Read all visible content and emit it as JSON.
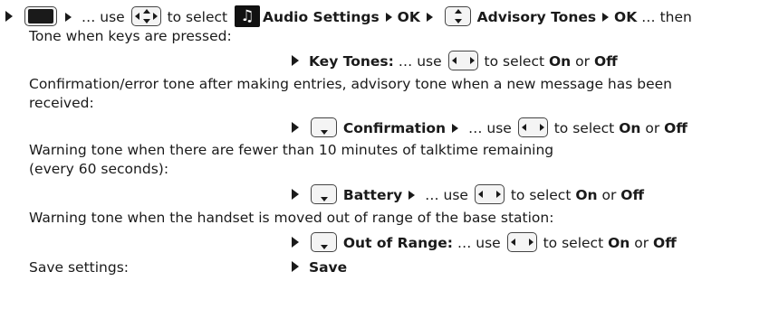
{
  "step1": {
    "prefix": "… use",
    "to_select": "to select",
    "audio_icon": "music-note",
    "audio_settings": "Audio Settings",
    "ok1": "OK",
    "advisory_tones": "Advisory Tones",
    "ok2": "OK",
    "then": "… then"
  },
  "key_tones": {
    "description": "Tone when keys are pressed:",
    "label": "Key Tones:",
    "use": "… use",
    "to_select": "to select",
    "on": "On",
    "or": "or",
    "off": "Off"
  },
  "confirmation": {
    "description_line1": "Confirmation/error tone after making entries, advisory tone when a new message has been",
    "description_line2": "received:",
    "label": "Confirmation",
    "use": "… use",
    "to_select": "to select",
    "on": "On",
    "or": "or",
    "off": "Off"
  },
  "battery": {
    "description_line1": "Warning tone when there are fewer than 10 minutes of talktime remaining",
    "description_line2": "(every 60 seconds):",
    "label": "Battery",
    "use": "… use",
    "to_select": "to select",
    "on": "On",
    "or": "or",
    "off": "Off"
  },
  "out_of_range": {
    "description": "Warning tone when the handset is moved out of range of the base station:",
    "label": "Out of Range:",
    "use": "… use",
    "to_select": "to select",
    "on": "On",
    "or": "or",
    "off": "Off"
  },
  "save": {
    "description": "Save settings:",
    "label": "Save"
  }
}
